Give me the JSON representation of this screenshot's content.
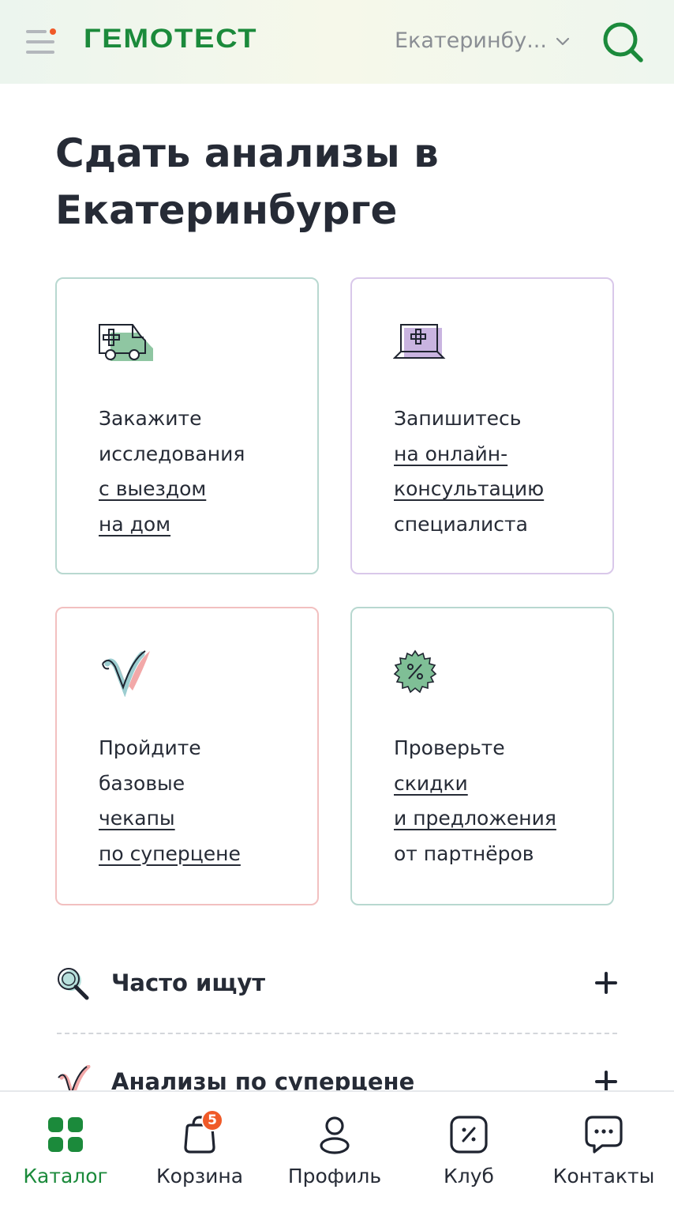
{
  "header": {
    "logo": "ГЕМОТЕСТ",
    "city": "Екатеринбу...",
    "colors": {
      "brand": "#1b8a3b",
      "notification_dot": "#f05a28"
    }
  },
  "page_title": "Сдать анализы в Екатеринбурге",
  "cards": [
    {
      "icon": "ambulance-icon",
      "lines": [
        "Закажите",
        "исследования"
      ],
      "links": [
        "с выездом",
        "на дом"
      ],
      "tail": []
    },
    {
      "icon": "laptop-medical-icon",
      "lines": [
        "Запишитесь"
      ],
      "links": [
        "на онлайн-",
        "консультацию"
      ],
      "tail": [
        "специалиста"
      ]
    },
    {
      "icon": "checkmark-icon",
      "lines": [
        "Пройдите",
        "базовые"
      ],
      "links": [
        "чекапы",
        "по суперцене"
      ],
      "tail": []
    },
    {
      "icon": "discount-badge-icon",
      "lines": [
        "Проверьте"
      ],
      "links": [
        "скидки",
        "и предложения"
      ],
      "tail": [
        "от партнёров"
      ]
    }
  ],
  "accordion": [
    {
      "icon": "magnifier-icon",
      "label": "Часто ищут"
    },
    {
      "icon": "checkmark-icon",
      "label": "Анализы по суперцене"
    }
  ],
  "bottom_nav": [
    {
      "icon": "catalog-grid-icon",
      "label": "Каталог",
      "active": true
    },
    {
      "icon": "cart-bag-icon",
      "label": "Корзина",
      "badge": "5"
    },
    {
      "icon": "profile-icon",
      "label": "Профиль"
    },
    {
      "icon": "club-discount-icon",
      "label": "Клуб"
    },
    {
      "icon": "chat-icon",
      "label": "Контакты"
    }
  ]
}
